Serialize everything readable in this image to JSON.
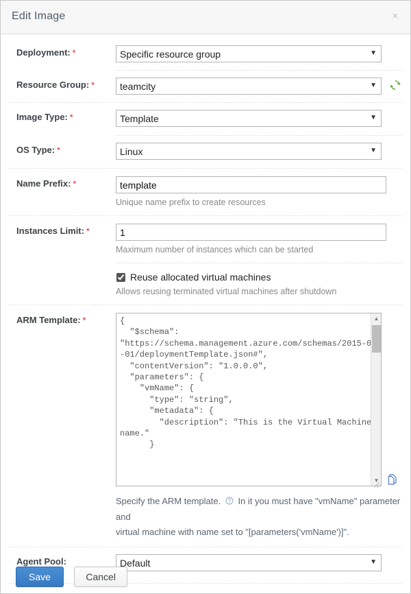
{
  "dialog": {
    "title": "Edit Image",
    "close_label": "×"
  },
  "fields": {
    "deployment": {
      "label": "Deployment:",
      "required": "*",
      "value": "Specific resource group"
    },
    "resource_group": {
      "label": "Resource Group:",
      "required": "*",
      "value": "teamcity",
      "refresh_icon": "refresh-icon"
    },
    "image_type": {
      "label": "Image Type:",
      "required": "*",
      "value": "Template"
    },
    "os_type": {
      "label": "OS Type:",
      "required": "*",
      "value": "Linux"
    },
    "name_prefix": {
      "label": "Name Prefix:",
      "required": "*",
      "value": "template",
      "hint": "Unique name prefix to create resources"
    },
    "instances_limit": {
      "label": "Instances Limit:",
      "required": "*",
      "value": "1",
      "hint": "Maximum number of instances which can be started"
    },
    "reuse_vms": {
      "label": "Reuse allocated virtual machines",
      "checked": true,
      "hint": "Allows reusing terminated virtual machines after shutdown"
    },
    "arm_template": {
      "label": "ARM Template:",
      "required": "*",
      "value": "{\n  \"$schema\":\n\"https://schema.management.azure.com/schemas/2015-01-01/deploymentTemplate.json#\",\n  \"contentVersion\": \"1.0.0.0\",\n  \"parameters\": {\n    \"vmName\": {\n      \"type\": \"string\",\n      \"metadata\": {\n        \"description\": \"This is the Virtual Machine name.\"\n      }",
      "help_before": "Specify the ARM template.",
      "help_icon": "question-mark-icon",
      "help_after": "In it you must have \"vmName\" parameter and",
      "help_line2": "virtual machine with name set to \"[parameters('vmName')]\".",
      "file_icon": "file-document-icon"
    },
    "agent_pool": {
      "label": "Agent Pool:",
      "value": "Default"
    }
  },
  "footer": {
    "save_label": "Save",
    "cancel_label": "Cancel"
  },
  "colors": {
    "accent": "#3778c2",
    "required": "#e05c5c",
    "refresh_green": "#5aa832",
    "file_blue": "#4a7ebb",
    "label": "#3d4349"
  }
}
